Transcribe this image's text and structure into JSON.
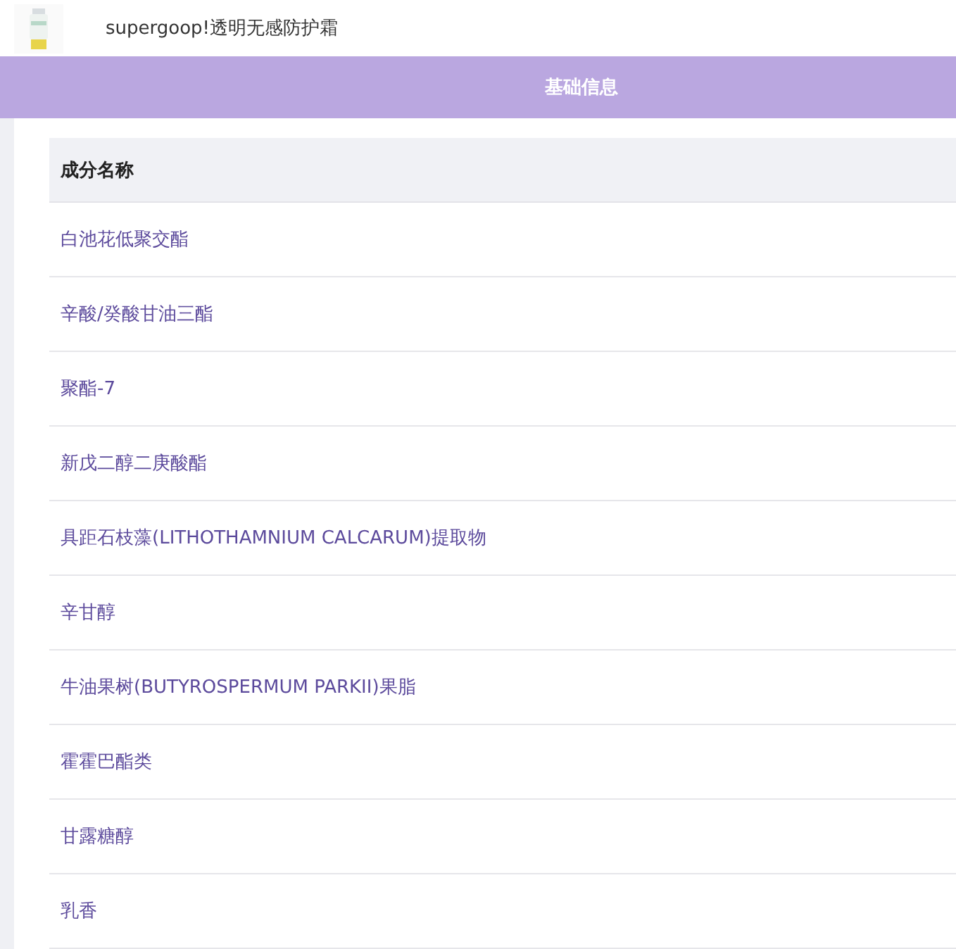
{
  "product": {
    "title": "supergoop!透明无感防护霜"
  },
  "section": {
    "title": "基础信息"
  },
  "table": {
    "columns": [
      "成分名称"
    ],
    "rows": [
      "白池花低聚交酯",
      "辛酸/癸酸甘油三酯",
      "聚酯-7",
      "新戊二醇二庚酸酯",
      "具距石枝藻(LITHOTHAMNIUM CALCARUM)提取物",
      "辛甘醇",
      "牛油果树(BUTYROSPERMUM PARKII)果脂",
      "霍霍巴酯类",
      "甘露糖醇",
      "乳香"
    ]
  }
}
